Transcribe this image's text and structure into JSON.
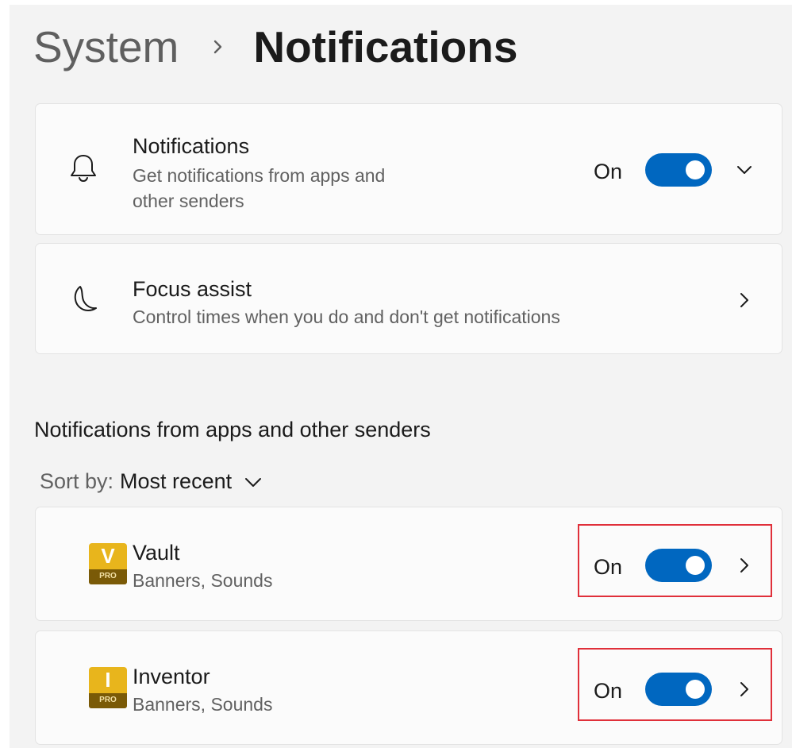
{
  "breadcrumb": {
    "parent": "System",
    "current": "Notifications"
  },
  "notifications_card": {
    "icon": "bell-icon",
    "title": "Notifications",
    "subtitle_line1": "Get notifications from apps and",
    "subtitle_line2": "other senders",
    "state_label": "On",
    "enabled": true
  },
  "focus_card": {
    "icon": "moon-icon",
    "title": "Focus assist",
    "subtitle": "Control times when you do and don't get notifications"
  },
  "section": {
    "title": "Notifications from apps and other senders"
  },
  "sort": {
    "label": "Sort by:",
    "value": "Most recent"
  },
  "apps": [
    {
      "name": "Vault",
      "icon_letter": "V",
      "icon_badge": "PRO",
      "detail": "Banners, Sounds",
      "state_label": "On",
      "enabled": true
    },
    {
      "name": "Inventor",
      "icon_letter": "I",
      "icon_badge": "PRO",
      "detail": "Banners, Sounds",
      "state_label": "On",
      "enabled": true
    }
  ],
  "colors": {
    "accent": "#0067c0",
    "highlight": "#e0303a",
    "app_icon_gold": "#e8b51c"
  }
}
